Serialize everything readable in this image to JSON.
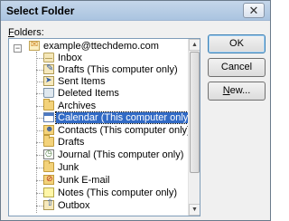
{
  "window": {
    "title": "Select Folder",
    "close_glyph": "✕"
  },
  "folders_label": {
    "underlined": "F",
    "rest": "olders:"
  },
  "tree": {
    "root": {
      "label": "example@ttechdemo.com",
      "expander": "−"
    },
    "items": [
      {
        "label": "Inbox",
        "icon": "inbox-icon"
      },
      {
        "label": "Drafts (This computer only)",
        "icon": "drafts-icon"
      },
      {
        "label": "Sent Items",
        "icon": "sent-items-icon"
      },
      {
        "label": "Deleted Items",
        "icon": "deleted-items-icon"
      },
      {
        "label": "Archives",
        "icon": "folder-icon"
      },
      {
        "label": "Calendar (This computer only)",
        "icon": "calendar-icon",
        "selected": true
      },
      {
        "label": "Contacts (This computer only)",
        "icon": "contacts-icon"
      },
      {
        "label": "Drafts",
        "icon": "folder-icon"
      },
      {
        "label": "Journal (This computer only)",
        "icon": "journal-icon"
      },
      {
        "label": "Junk",
        "icon": "folder-icon"
      },
      {
        "label": "Junk E-mail",
        "icon": "junk-icon"
      },
      {
        "label": "Notes (This computer only)",
        "icon": "notes-icon"
      },
      {
        "label": "Outbox",
        "icon": "outbox-icon"
      }
    ]
  },
  "buttons": {
    "ok": "OK",
    "cancel": "Cancel",
    "new_underlined": "N",
    "new_rest": "ew..."
  },
  "colors": {
    "selection": "#316ac5",
    "dialog_bg": "#f0f0f0"
  }
}
